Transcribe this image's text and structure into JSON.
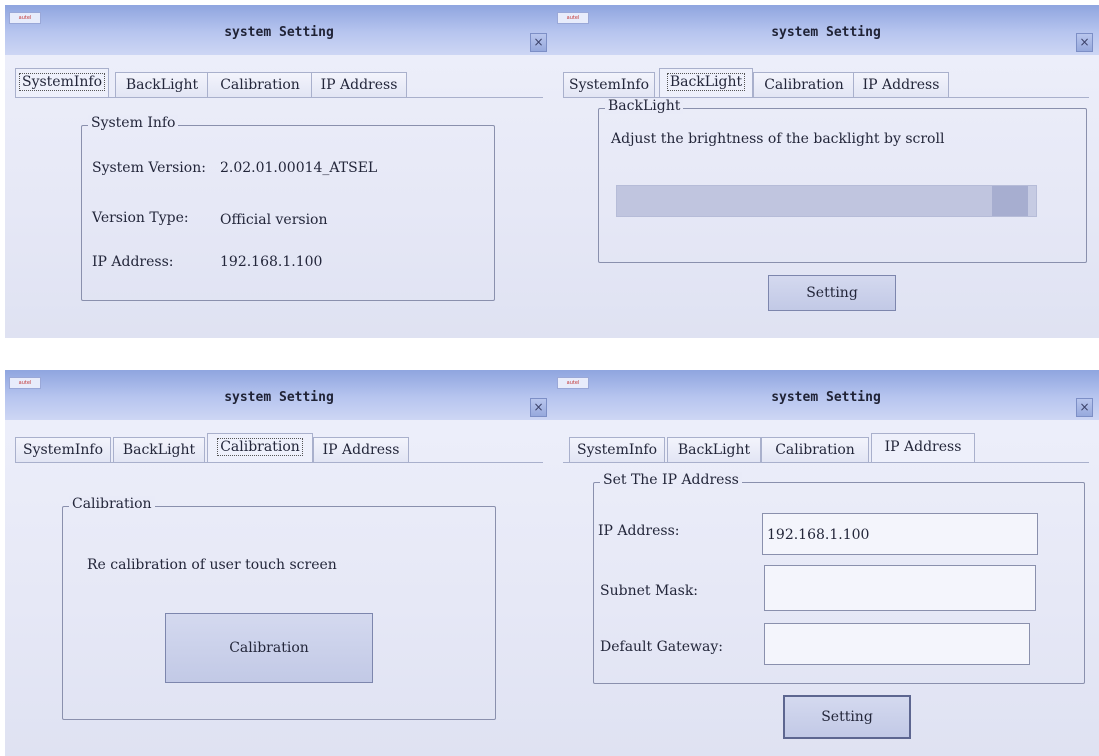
{
  "window": {
    "title": "system Setting",
    "close_label": "×",
    "logo_text": "autel"
  },
  "tabs": [
    "SystemInfo",
    "BackLight",
    "Calibration",
    "IP Address"
  ],
  "panels": {
    "system_info": {
      "group_title": "System Info",
      "rows": [
        {
          "label": "System Version:",
          "value": "2.02.01.00014_ATSEL"
        },
        {
          "label": "Version Type:",
          "value": "Official version"
        },
        {
          "label": "IP Address:",
          "value": "192.168.1.100"
        }
      ]
    },
    "backlight": {
      "group_title": "BackLight",
      "description": "Adjust the brightness of the backlight by scroll",
      "brightness_fraction": 0.98,
      "button_label": "Setting"
    },
    "calibration": {
      "group_title": "Calibration",
      "description": "Re calibration of user touch screen",
      "button_label": "Calibration"
    },
    "ip_address": {
      "group_title": "Set The IP Address",
      "fields": [
        {
          "label": "IP Address:",
          "value": "192.168.1.100"
        },
        {
          "label": "Subnet Mask:",
          "value": ""
        },
        {
          "label": "Default Gateway:",
          "value": ""
        }
      ],
      "button_label": "Setting"
    }
  },
  "colors": {
    "titlebar": "#8fa5df",
    "window_bg": "#eef0fb",
    "border": "#8a90ad"
  }
}
